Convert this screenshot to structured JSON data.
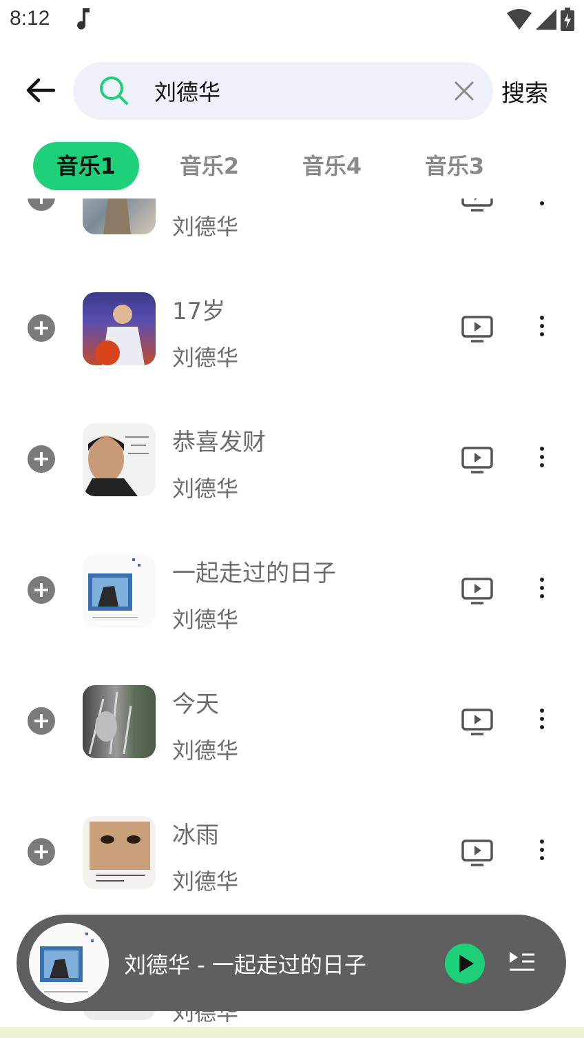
{
  "status_bar": {
    "time": "8:12"
  },
  "search": {
    "query": "刘德华",
    "submit_label": "搜索"
  },
  "tabs": [
    {
      "label": "音乐1",
      "active": true
    },
    {
      "label": "音乐2",
      "active": false
    },
    {
      "label": "音乐4",
      "active": false
    },
    {
      "label": "音乐3",
      "active": false
    }
  ],
  "songs": [
    {
      "title": "",
      "artist": "刘德华"
    },
    {
      "title": "17岁",
      "artist": "刘德华"
    },
    {
      "title": "恭喜发财",
      "artist": "刘德华"
    },
    {
      "title": "一起走过的日子",
      "artist": "刘德华"
    },
    {
      "title": "今天",
      "artist": "刘德华"
    },
    {
      "title": "冰雨",
      "artist": "刘德华"
    },
    {
      "title": "",
      "artist": "刘德华"
    }
  ],
  "player": {
    "now_playing": "刘德华 - 一起走过的日子"
  },
  "colors": {
    "accent": "#1fd07a",
    "player_bg": "#5f5f5f",
    "search_bg": "#eef1f9"
  },
  "icons": [
    "back-arrow-icon",
    "search-icon",
    "clear-icon",
    "plus-icon",
    "mv-play-icon",
    "more-vert-icon",
    "play-icon",
    "queue-list-icon",
    "music-note-icon",
    "wifi-icon",
    "signal-icon",
    "battery-icon"
  ]
}
